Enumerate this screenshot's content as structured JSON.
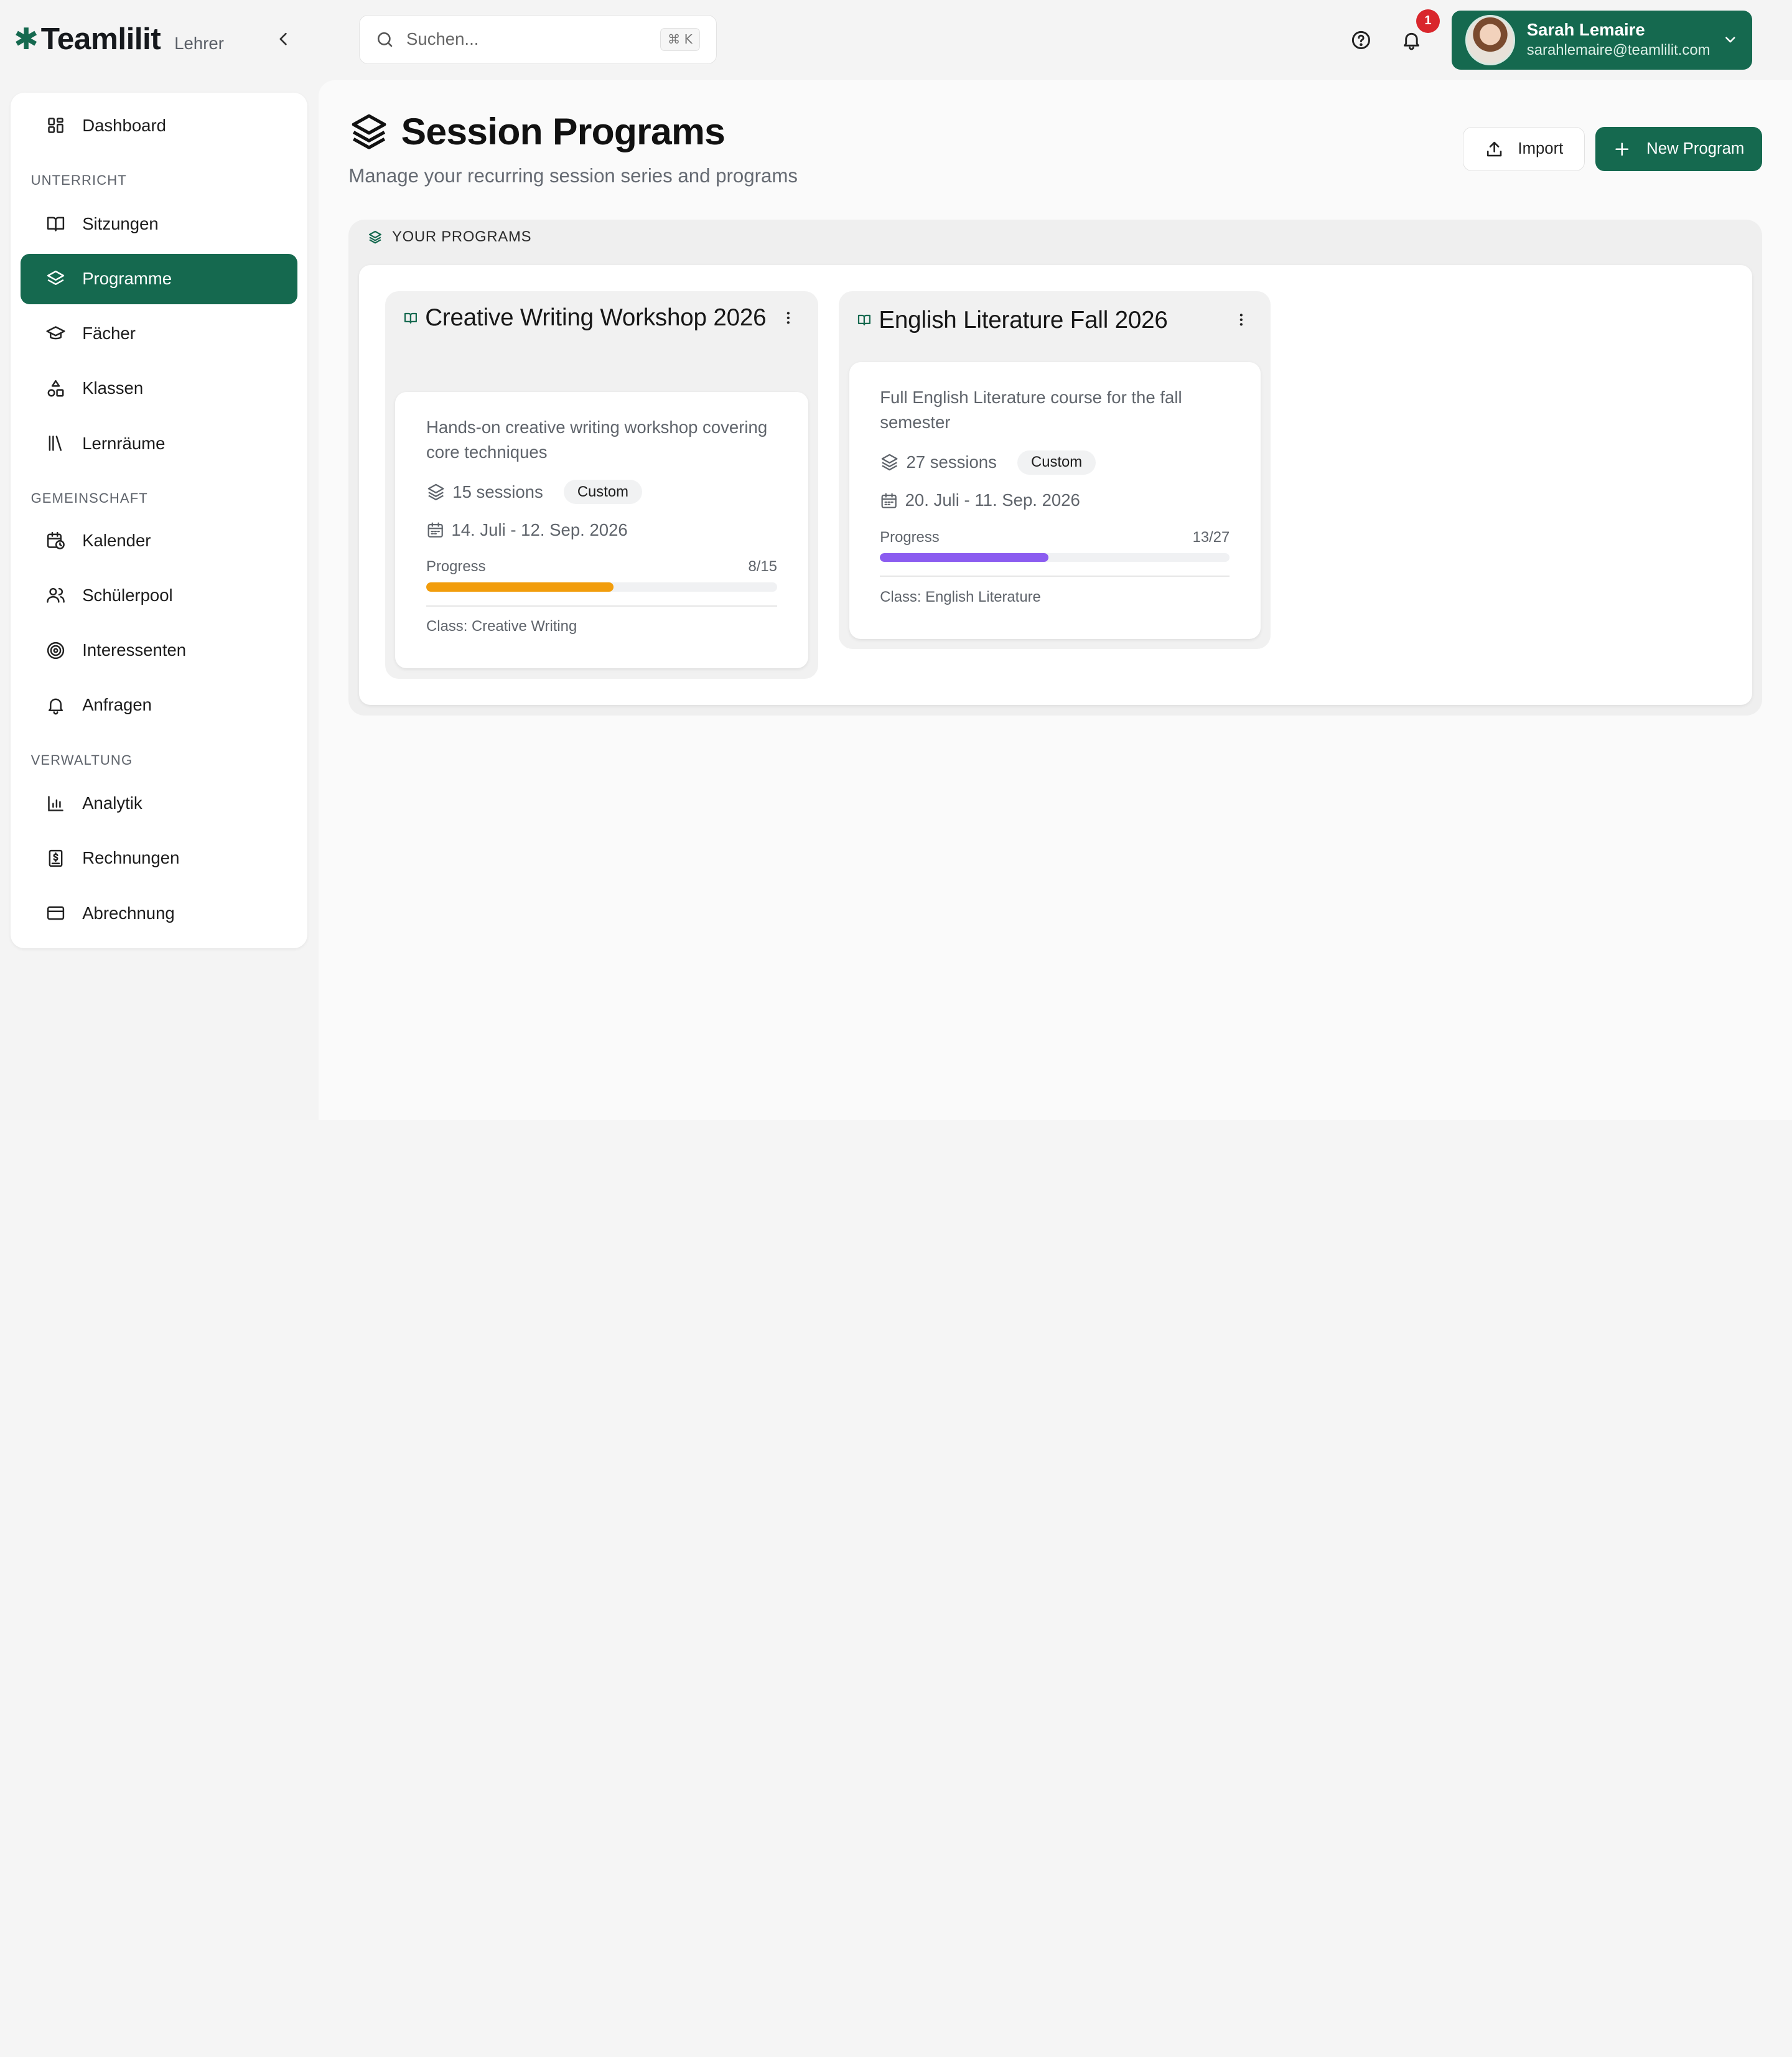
{
  "brand": {
    "name": "Teamlilit",
    "role": "Lehrer",
    "mark": "✱"
  },
  "search": {
    "placeholder": "Suchen...",
    "shortcut": "⌘ K"
  },
  "notifications": {
    "count": "1"
  },
  "user": {
    "name": "Sarah Lemaire",
    "email": "sarahlemaire@teamlilit.com"
  },
  "sidebar": {
    "dashboard": "Dashboard",
    "sections": {
      "unterricht": "UNTERRICHT",
      "gemeinschaft": "GEMEINSCHAFT",
      "verwaltung": "VERWALTUNG"
    },
    "items": {
      "sitzungen": "Sitzungen",
      "programme": "Programme",
      "faecher": "Fächer",
      "klassen": "Klassen",
      "lernraeume": "Lernräume",
      "kalender": "Kalender",
      "schuelerpool": "Schülerpool",
      "interessenten": "Interessenten",
      "anfragen": "Anfragen",
      "analytik": "Analytik",
      "rechnungen": "Rechnungen",
      "abrechnung": "Abrechnung"
    },
    "active": "programme"
  },
  "page": {
    "title": "Session Programs",
    "subtitle": "Manage your recurring session series and programs",
    "import_label": "Import",
    "new_label": "New Program",
    "panel_title": "YOUR PROGRAMS"
  },
  "programs": [
    {
      "title": "Creative Writing Workshop 2026",
      "description": "Hands-on creative writing workshop covering core techniques",
      "sessions": "15 sessions",
      "tag": "Custom",
      "dates": "14. Juli - 12. Sep. 2026",
      "progress_label": "Progress",
      "progress_text": "8/15",
      "progress": 0.533,
      "progress_color": "#f29d0c",
      "class": "Class: Creative Writing"
    },
    {
      "title": "English Literature Fall 2026",
      "description": "Full English Literature course for the fall semester",
      "sessions": "27 sessions",
      "tag": "Custom",
      "dates": "20. Juli - 11. Sep. 2026",
      "progress_label": "Progress",
      "progress_text": "13/27",
      "progress": 0.481,
      "progress_color": "#8b5cf0",
      "class": "Class: English Literature"
    }
  ],
  "colors": {
    "brand": "#15694f",
    "badge": "#d9262c"
  }
}
